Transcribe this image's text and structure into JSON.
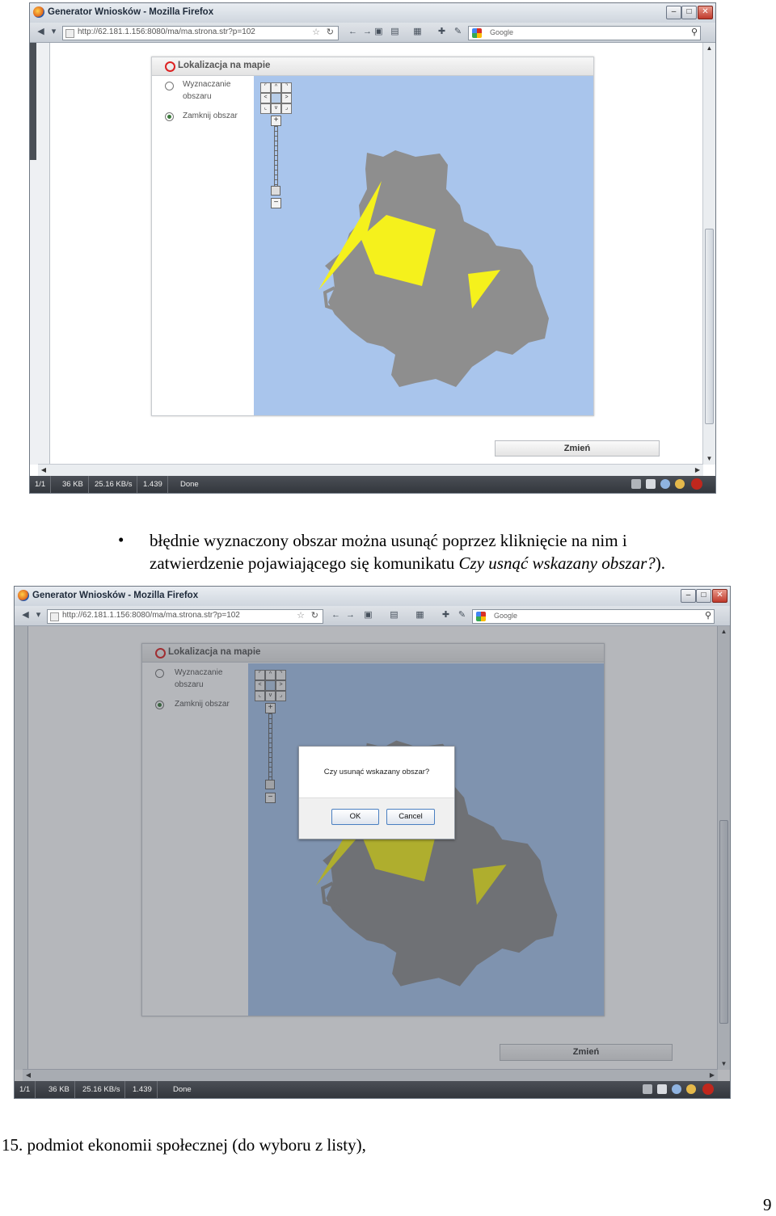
{
  "browser": {
    "title": "Generator Wniosków - Mozilla Firefox",
    "url": "http://62.181.1.156:8080/ma/ma.strona.str?p=102",
    "search_placeholder": "Google",
    "status": {
      "pages": "1/1",
      "size": "36 KB",
      "speed": "25.16 KB/s",
      "time": "1.439",
      "state": "Done"
    }
  },
  "app": {
    "panel_title": "Lokalizacja na mapie",
    "option_1": "Wyznaczanie obszaru",
    "option_1_line1": "Wyznaczanie",
    "option_1_line2": "obszaru",
    "option_2": "Zamknij obszar",
    "change_button": "Zmień"
  },
  "dialog": {
    "message": "Czy usunąć wskazany obszar?",
    "ok": "OK",
    "cancel": "Cancel"
  },
  "colors": {
    "map_bg": "#a9c5ec",
    "region": "#8e8e8e",
    "highlight": "#f5f11c"
  },
  "text": {
    "bullet_line1": "błędnie wyznaczony obszar można usunąć poprzez kliknięcie na nim i",
    "bullet_line2_plain": "zatwierdzenie pojawiającego się komunikatu ",
    "bullet_line2_italic": "Czy usnąć wskazany obszar?",
    "bullet_line2_end": ").",
    "item_15": "15. podmiot ekonomii społecznej (do wyboru z listy),",
    "page_number": "9"
  }
}
